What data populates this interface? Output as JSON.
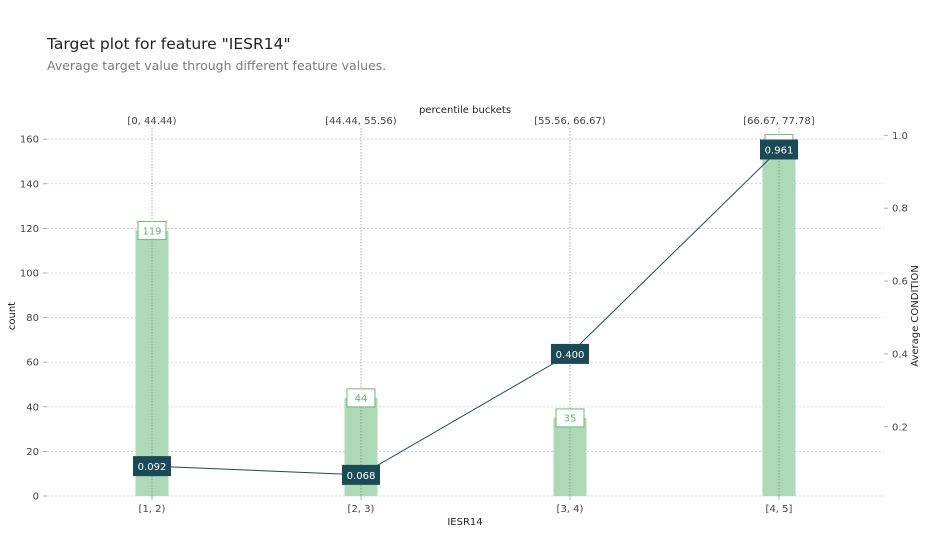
{
  "header": {
    "title": "Target plot for feature \"IESR14\"",
    "subtitle": "Average target value through different feature values."
  },
  "chart_data": {
    "type": "bar",
    "title": "Target plot for feature \"IESR14\"",
    "subtitle": "Average target value through different feature values.",
    "xlabel": "IESR14",
    "ylabel": "count",
    "y2label": "Average CONDITION",
    "top_axis_label": "percentile buckets",
    "categories": [
      "[1, 2)",
      "[2, 3)",
      "[3, 4)",
      "[4, 5]"
    ],
    "percentile_buckets": [
      "[0, 44.44)",
      "[44.44, 55.56)",
      "[55.56, 66.67)",
      "[66.67, 77.78]"
    ],
    "series": [
      {
        "name": "count",
        "axis": "left",
        "kind": "bar",
        "values": [
          119,
          44,
          35,
          158
        ]
      },
      {
        "name": "Average CONDITION",
        "axis": "right",
        "kind": "line",
        "values": [
          0.092,
          0.068,
          0.4,
          0.961
        ]
      }
    ],
    "count_labels": [
      "119",
      "44",
      "35",
      ""
    ],
    "avg_labels": [
      "0.092",
      "0.068",
      "0.400",
      "0.961"
    ],
    "ylim": [
      0,
      165
    ],
    "yticks": [
      0,
      20,
      40,
      60,
      80,
      100,
      120,
      140,
      160
    ],
    "y2lim": [
      0.01,
      1.02
    ],
    "y2ticks": [
      0.2,
      0.4,
      0.6,
      0.8,
      1.0
    ],
    "y2ticklabels": [
      "0.2",
      "0.4",
      "0.6",
      "0.8",
      "1.0"
    ],
    "grid": true,
    "colors": {
      "bar": "#aed9b6",
      "bar_label": "#5fb36e",
      "line": "#1a4a55",
      "grid": "#c8c8c8"
    }
  }
}
